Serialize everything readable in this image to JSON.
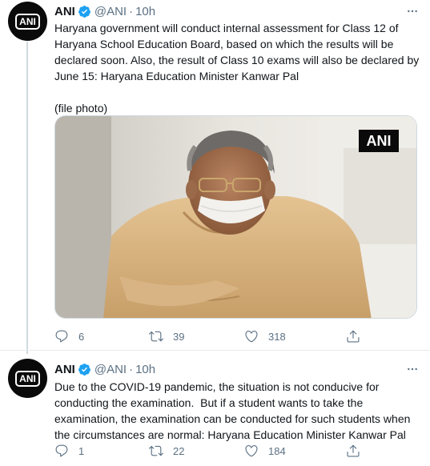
{
  "tweets": [
    {
      "avatar_text": "ANI",
      "name": "ANI",
      "handle": "@ANI",
      "separator": "·",
      "time": "10h",
      "text": "Haryana government will conduct internal assessment for Class 12 of Haryana School Education Board, based on which the results will be declared soon. Also, the result of Class 10 exams will also be declared by June 15: Haryana Education Minister Kanwar Pal\n\n(file photo)",
      "media_watermark": "ANI",
      "replies": "6",
      "retweets": "39",
      "likes": "318"
    },
    {
      "avatar_text": "ANI",
      "name": "ANI",
      "handle": "@ANI",
      "separator": "·",
      "time": "10h",
      "text": "Due to the COVID-19 pandemic, the situation is not conducive for conducting the examination.  But if a student wants to take the examination, the examination can be conducted for such students when the circumstances are normal: Haryana Education Minister Kanwar Pal",
      "replies": "1",
      "retweets": "22",
      "likes": "184"
    }
  ],
  "icons": {
    "verified": "verified-badge-icon",
    "more": "more-options-icon",
    "reply": "reply-icon",
    "retweet": "retweet-icon",
    "like": "like-icon",
    "share": "share-icon"
  },
  "colors": {
    "text_primary": "#0f1419",
    "text_secondary": "#5b7083",
    "verified_blue": "#1da1f2",
    "thread_line": "#cfd9de",
    "ani_black": "#0a0a0a"
  }
}
